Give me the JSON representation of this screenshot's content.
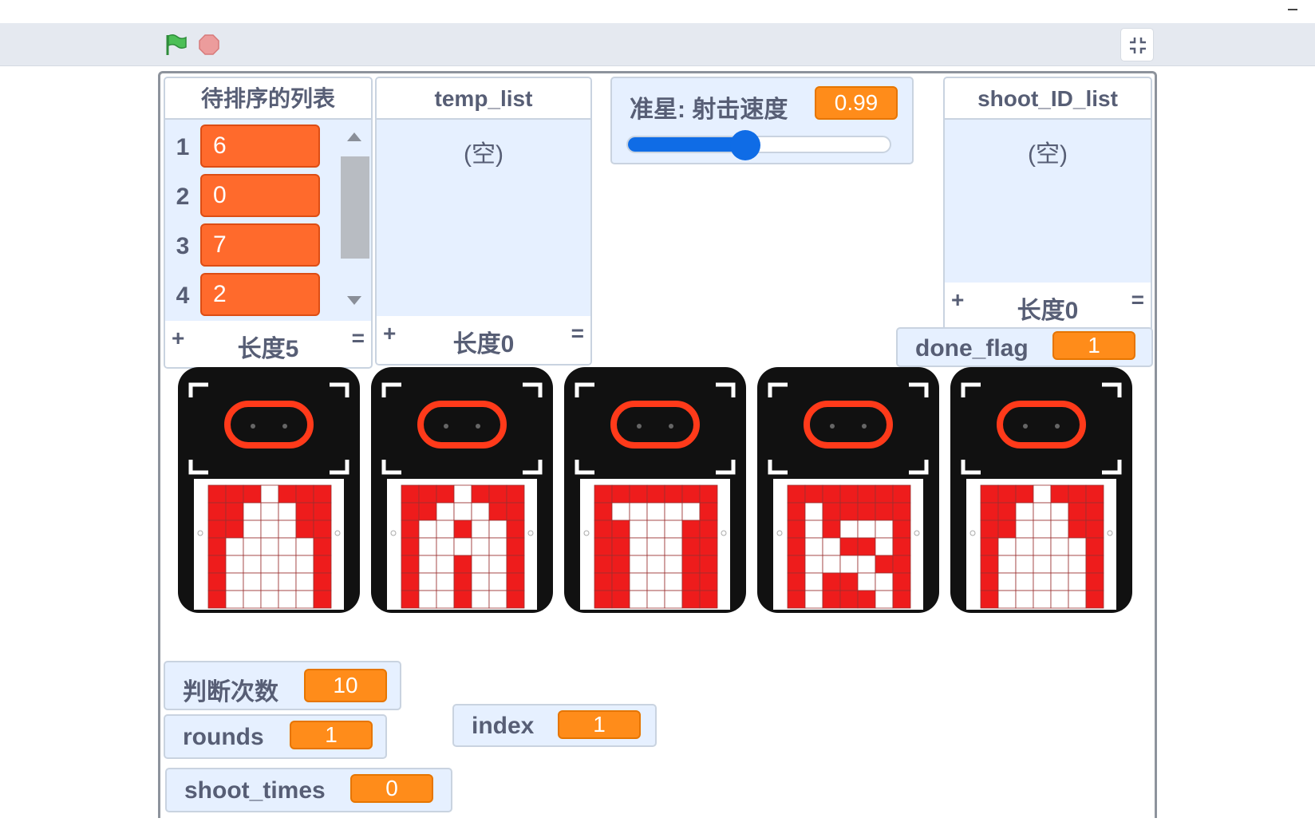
{
  "window": {
    "minimize_label": "minimize"
  },
  "controls": {
    "green_flag_icon": "green-flag-icon",
    "stop_icon": "stop-icon",
    "fullscreen_icon": "unfullscreen-icon",
    "flag_color": "#4cbf56",
    "stop_color": "#ec9c9c"
  },
  "monitors": {
    "sort_list": {
      "title": "待排序的列表",
      "items": [
        {
          "index": "1",
          "value": "6"
        },
        {
          "index": "2",
          "value": "0"
        },
        {
          "index": "3",
          "value": "7"
        },
        {
          "index": "4",
          "value": "2"
        }
      ],
      "plus": "+",
      "length": "长度5",
      "eq": "="
    },
    "temp_list": {
      "title": "temp_list",
      "empty": "(空)",
      "plus": "+",
      "length": "长度0",
      "eq": "="
    },
    "shoot_speed": {
      "label": "准星: 射击速度",
      "value": "0.99",
      "slider_fraction": 0.44
    },
    "shoot_id_list": {
      "title": "shoot_ID_list",
      "empty": "(空)",
      "plus": "+",
      "length": "长度0",
      "eq": "="
    },
    "done_flag": {
      "label": "done_flag",
      "value": "1"
    },
    "judge_count": {
      "label": "判断次数",
      "value": "10"
    },
    "rounds": {
      "label": "rounds",
      "value": "1"
    },
    "index": {
      "label": "index",
      "value": "1"
    },
    "shoot_times": {
      "label": "shoot_times",
      "value": "0"
    }
  },
  "sprites": [
    {
      "name": "robot-sprite-1",
      "glyph": [
        "0001000",
        "0011100",
        "0011100",
        "0111110",
        "0111110",
        "0111110",
        "0111110"
      ]
    },
    {
      "name": "robot-sprite-2",
      "glyph": [
        "0001000",
        "0011100",
        "0110110",
        "0111110",
        "0110110",
        "0110110",
        "0110110"
      ]
    },
    {
      "name": "robot-sprite-3",
      "glyph": [
        "0000000",
        "0111110",
        "0011100",
        "0011100",
        "0011100",
        "0011100",
        "0011100"
      ]
    },
    {
      "name": "robot-sprite-4",
      "glyph": [
        "0000000",
        "0100000",
        "0101110",
        "0110010",
        "0111100",
        "0100110",
        "0100010"
      ]
    },
    {
      "name": "robot-sprite-5",
      "glyph": [
        "0001000",
        "0011100",
        "0011100",
        "0111110",
        "0111110",
        "0111110",
        "0111110"
      ]
    }
  ],
  "colors": {
    "list_item": "#ff6a2c",
    "var_value": "#ff8c1a",
    "slider": "#0f6ce6",
    "robot_body": "#111111",
    "robot_led": "#ff3a1a",
    "screen_red": "#ee1c1c"
  }
}
